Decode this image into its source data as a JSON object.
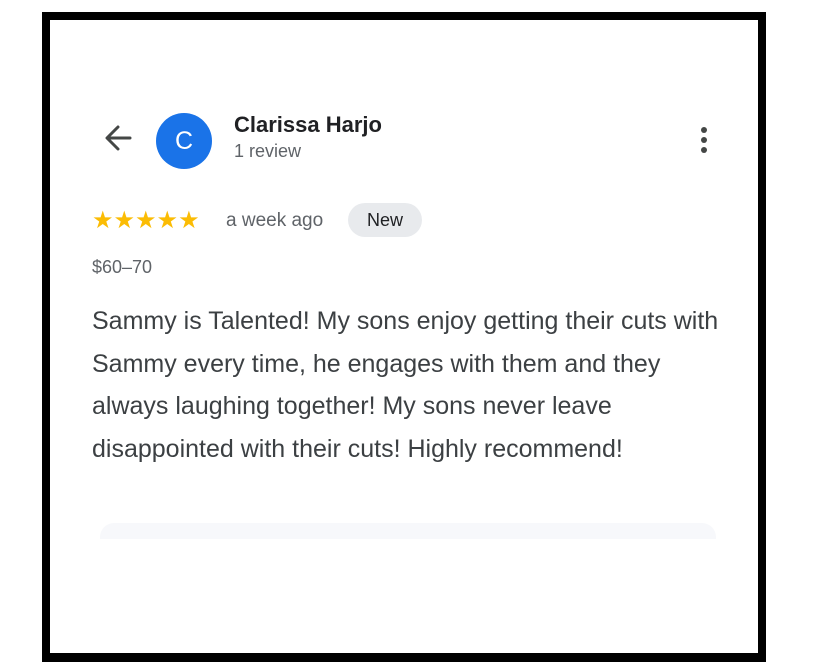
{
  "reviewer": {
    "avatar_letter": "C",
    "avatar_color": "#1a73e8",
    "name": "Clarissa Harjo",
    "review_count": "1 review"
  },
  "review": {
    "rating": 5,
    "star_color": "#fbbc04",
    "stars": [
      "★",
      "★",
      "★",
      "★",
      "★"
    ],
    "time_ago": "a week ago",
    "badge": "New",
    "price": "$60–70",
    "text": "Sammy is Talented! My sons enjoy getting their cuts with Sammy every time, he engages with them and they always laughing together! My sons never leave disappointed with their cuts! Highly recommend!"
  },
  "icons": {
    "back": "arrow-back-icon",
    "menu": "more-vert-icon",
    "star": "star-icon"
  }
}
